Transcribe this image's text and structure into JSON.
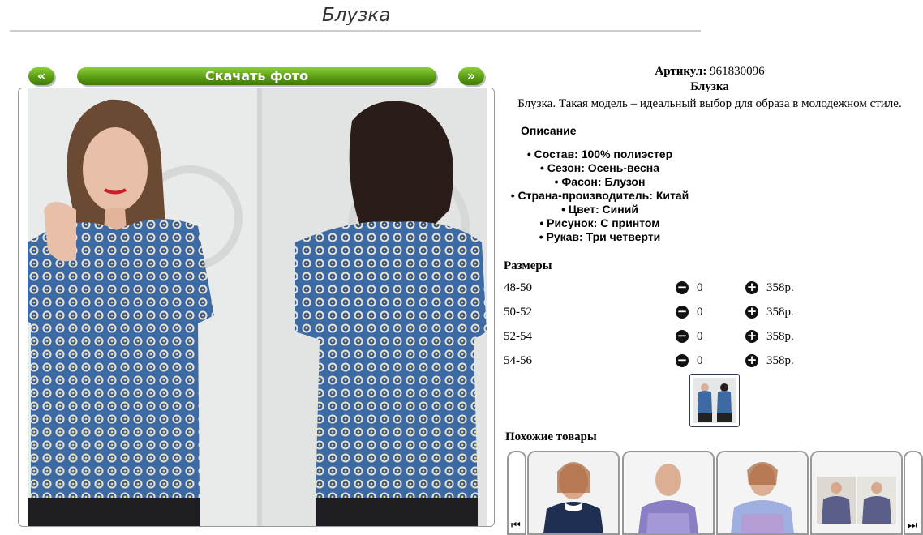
{
  "page": {
    "title": "Блузка"
  },
  "gallery": {
    "prev_label": "«",
    "download_label": "Скачать фото",
    "next_label": "»"
  },
  "product": {
    "article_label": "Артикул:",
    "article_value": "961830096",
    "name": "Блузка",
    "description": "Блузка. Такая модель – идеальный выбор для образа в молодежном стиле."
  },
  "details": {
    "heading": "Описание",
    "items": [
      "Состав: 100% полиэстер",
      "Сезон: Осень-весна",
      "Фасон: Блузон",
      "Страна-производитель: Китай",
      "Цвет: Синий",
      "Рисунок: С принтом",
      "Рукав: Три четверти"
    ]
  },
  "sizes": {
    "heading": "Размеры",
    "rows": [
      {
        "label": "48-50",
        "qty": "0",
        "price": "358р."
      },
      {
        "label": "50-52",
        "qty": "0",
        "price": "358р."
      },
      {
        "label": "52-54",
        "qty": "0",
        "price": "358р."
      },
      {
        "label": "54-56",
        "qty": "0",
        "price": "358р."
      }
    ]
  },
  "similar": {
    "heading": "Похожие товары"
  },
  "colors": {
    "accent_green": "#5b9e14",
    "blouse_blue": "#3d6aa3"
  }
}
